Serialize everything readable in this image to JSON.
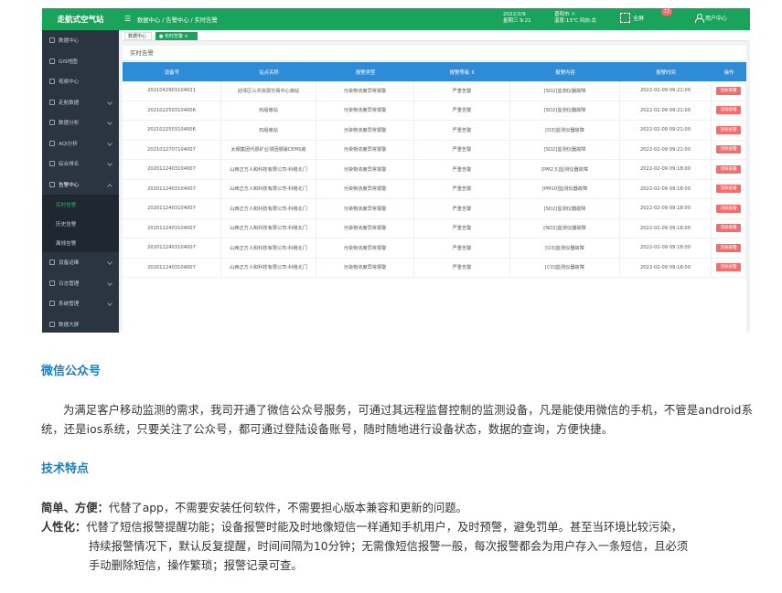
{
  "app": {
    "logo": "走航式空气站"
  },
  "header": {
    "breadcrumb": "数据中心 / 告警中心 / 实时告警",
    "date": "2022/2/9",
    "time": "星期三 9:21",
    "weather_city": "晋阳市 ☼",
    "weather_detail": "温度:13℃ 风向:北",
    "fullscreen_label": "全屏",
    "notification_count": "12",
    "user_label": "用户中心",
    "accent_color": "#1aa35a"
  },
  "sidebar": {
    "items": [
      {
        "label": "数据中心",
        "icon": "home-icon"
      },
      {
        "label": "GIS地图",
        "icon": "map-icon"
      },
      {
        "label": "视频中心",
        "icon": "video-icon"
      },
      {
        "label": "走航数据",
        "icon": "car-icon"
      },
      {
        "label": "数据分析",
        "icon": "bar-chart-icon"
      },
      {
        "label": "AQI分析",
        "icon": "gauge-icon"
      },
      {
        "label": "综合排名",
        "icon": "rank-icon"
      },
      {
        "label": "告警中心",
        "icon": "bell-icon"
      }
    ],
    "sub_items": [
      {
        "label": "实时告警",
        "active": true
      },
      {
        "label": "历史告警",
        "active": false
      },
      {
        "label": "离线告警",
        "active": false
      }
    ],
    "bottom_items": [
      {
        "label": "设备运维",
        "icon": "wrench-icon"
      },
      {
        "label": "日志管理",
        "icon": "log-icon"
      },
      {
        "label": "系统管理",
        "icon": "settings-icon"
      },
      {
        "label": "数据大屏",
        "icon": "screen-icon"
      }
    ]
  },
  "tabs": {
    "home": "数据中心",
    "realtime": "● 实时告警 ×"
  },
  "panel": {
    "title": "实时告警",
    "columns": [
      "设备号",
      "站点名称",
      "报警类型",
      "报警等级 ⇕",
      "报警内容",
      "报警时间",
      "操作"
    ],
    "rows": [
      [
        "2021042903104021",
        "迎泽区公共资源交易中心南站",
        "污染物浓度异常报警",
        "严重告警",
        "[SO2]监测仪器故障",
        "2022-02-09 09:21:00"
      ],
      [
        "2021022503104006",
        "石船南站",
        "污染物浓度异常报警",
        "严重告警",
        "[SO2]监测仪器故障",
        "2022-02-09 09:21:00"
      ],
      [
        "2021022503104006",
        "石船南站",
        "污染物浓度异常报警",
        "严重告警",
        "[O3]监测仪器故障",
        "2022-02-09 09:21:00"
      ],
      [
        "2021012707104007",
        "太钢集团代县矿业球团脱硝CEMS房",
        "污染物浓度异常报警",
        "严重告警",
        "[SO2]监测仪器故障",
        "2022-02-09 09:21:00"
      ],
      [
        "2020112403104007",
        "山西正方人和科技有限公司-科络北门",
        "污染物浓度异常报警",
        "严重告警",
        "[PM2.5]监测仪器故障",
        "2022-02-09 09:18:00"
      ],
      [
        "2020112403104007",
        "山西正方人和科技有限公司-科络北门",
        "污染物浓度异常报警",
        "严重告警",
        "[PM10]监测仪器故障",
        "2022-02-09 09:18:00"
      ],
      [
        "2020112403104007",
        "山西正方人和科技有限公司-科络北门",
        "污染物浓度异常报警",
        "严重告警",
        "[SO2]监测仪器故障",
        "2022-02-09 09:18:00"
      ],
      [
        "2020112403104007",
        "山西正方人和科技有限公司-科络北门",
        "污染物浓度异常报警",
        "严重告警",
        "[NO2]监测仪器故障",
        "2022-02-09 09:18:00"
      ],
      [
        "2020112403104007",
        "山西正方人和科技有限公司-科络北门",
        "污染物浓度异常报警",
        "严重告警",
        "[O3]监测仪器故障",
        "2022-02-09 09:18:00"
      ],
      [
        "2020112403104007",
        "山西正方人和科技有限公司-科络北门",
        "污染物浓度异常报警",
        "严重告警",
        "[CO]监测仪器故障",
        "2022-02-09 09:18:00"
      ]
    ],
    "action_label": "消除报警",
    "header_color": "#2e8bd7",
    "action_color": "#f56c6c"
  },
  "article": {
    "wechat_title": "微信公众号",
    "wechat_para": "为满足客户移动监测的需求，我司开通了微信公众号服务，可通过其远程监督控制的监测设备，凡是能使用微信的手机，不管是android系统，还是ios系统，只要关注了公众号，都可通过登陆设备账号，随时随地进行设备状态，数据的查询，方便快捷。",
    "tech_title": "技术特点",
    "feat1_label": "简单、方便：",
    "feat1_text": "代替了app，不需要安装任何软件，不需要担心版本兼容和更新的问题。",
    "feat2_label": "人性化：",
    "feat2_line1": "代替了短信报警提醒功能；设备报警时能及时地像短信一样通知手机用户，及时预警，避免罚单。甚至当环境比较污染，",
    "feat2_line2": "持续报警情况下，默认反复提醒，时间间隔为10分钟；无需像短信报警一般，每次报警都会为用户存入一条短信，且必须",
    "feat2_line3": "手动删除短信，操作繁琐；报警记录可查。",
    "title_color": "#1a7fc1"
  }
}
